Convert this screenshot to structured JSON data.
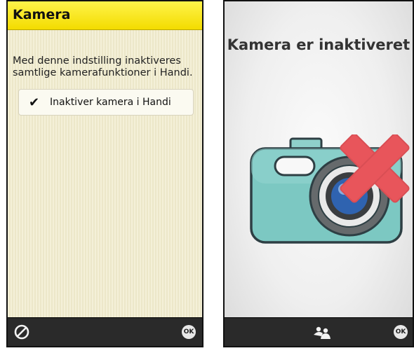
{
  "left_screen": {
    "header": {
      "title": "Kamera"
    },
    "description": "Med denne indstilling inaktiveres samtlige kamerafunktioner i Handi.",
    "setting": {
      "label": "Inaktiver kamera i Handi",
      "checked": true,
      "check_glyph": "✔"
    },
    "bottom_bar": {
      "cancel_icon": "cancel-icon",
      "ok_label": "OK"
    }
  },
  "right_screen": {
    "title": "Kamera er inaktiveret",
    "illustration": "camera-disabled-icon",
    "bottom_bar": {
      "people_icon": "people-icon",
      "ok_label": "OK"
    }
  },
  "colors": {
    "header_yellow": "#f7e400",
    "camera_teal": "#7cc8c2",
    "cross_red": "#e8555b",
    "bar_dark": "#2a2a2a"
  }
}
